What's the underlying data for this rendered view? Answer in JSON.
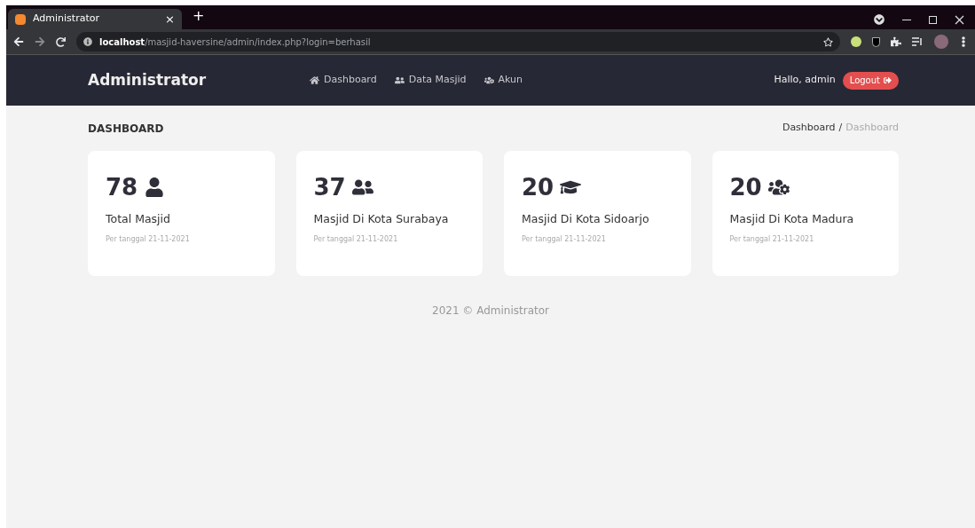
{
  "browser": {
    "tab": {
      "title": "Administrator",
      "close": "×"
    },
    "new_tab": "+",
    "url": "**localhost**/masjid-haversine/admin/index.php?login=berhasil"
  },
  "navbar": {
    "brand": "Administrator",
    "items": [
      {
        "label": "Dashboard"
      },
      {
        "label": "Data Masjid"
      },
      {
        "label": "Akun"
      }
    ],
    "greeting": "Hallo, admin",
    "logout": "Logout"
  },
  "page": {
    "title": "DASHBOARD",
    "breadcrumb": [
      {
        "label": "Dashboard",
        "current": false
      },
      {
        "label": "Dashboard",
        "current": true
      }
    ],
    "breadcrumb_separator": "/"
  },
  "cards": [
    {
      "value": "78",
      "label": "Total Masjid",
      "date": "Per tanggal 21-11-2021"
    },
    {
      "value": "37",
      "label": "Masjid Di Kota Surabaya",
      "date": "Per tanggal 21-11-2021"
    },
    {
      "value": "20",
      "label": "Masjid Di Kota Sidoarjo",
      "date": "Per tanggal 21-11-2021"
    },
    {
      "value": "20",
      "label": "Masjid Di Kota Madura",
      "date": "Per tanggal 21-11-2021"
    }
  ],
  "footer": "2021 © Administrator"
}
